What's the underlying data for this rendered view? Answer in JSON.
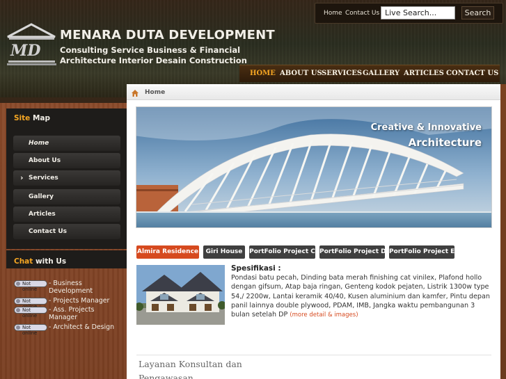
{
  "header": {
    "title": "MENARA DUTA DEVELOPMENT",
    "subtitle_line1": "Consulting Service Business & Financial",
    "subtitle_line2": "Architecture Interior Desain Construction",
    "logo_icon": "building-columns-logo",
    "top_links": [
      "Home",
      "Contact Us"
    ],
    "search": {
      "placeholder": "Live Search...",
      "button_label": "Search"
    }
  },
  "nav": {
    "items": [
      "HOME",
      "ABOUT US",
      "SERVICES",
      "GALLERY",
      "ARTICLES",
      "CONTACT US"
    ],
    "active_index": 0,
    "active_color": "#f5a623"
  },
  "breadcrumb": {
    "icon": "home-icon",
    "label": "Home"
  },
  "banner": {
    "line1": "Creative & Innovative",
    "line2": "Architecture"
  },
  "tabs": {
    "items": [
      "Almira Residence",
      "Giri House",
      "PortFolio Project C",
      "PortFolio Project D",
      "PortFolio Project E"
    ],
    "active_index": 0,
    "active_color": "#d64a1f"
  },
  "feature": {
    "spec_title": "Spesifikasi :",
    "spec_body": "Pondasi batu pecah, Dinding bata merah finishing cat vinilex, Plafond hollo dengan gifsum, Atap baja ringan, Genteng kodok pejaten, Listrik 1300w type 54,/ 2200w, Lantai keramik 40/40, Kusen aluminium dan kamfer, Pintu depan panil lainnya double plywood, PDAM, IMB, Jangka waktu pembangunan 3 bulan setelah DP",
    "more_link": "(more detail & images)"
  },
  "section": {
    "title": "Layanan Konsultan dan Pengawasan"
  },
  "sidebar": {
    "sitemap": {
      "head_accent": "Site",
      "head_rest": " Map"
    },
    "menu": [
      "Home",
      "About Us",
      "Services",
      "Gallery",
      "Articles",
      "Contact Us"
    ],
    "current_index": 0,
    "expanded_index": 2,
    "chat": {
      "head_accent": "Chat",
      "head_rest": " with Us",
      "badge_label": "Not online",
      "contacts": [
        "- Business Development",
        "- Projects Manager",
        "- Ass. Projects Manager",
        "- Architect & Design"
      ]
    }
  }
}
